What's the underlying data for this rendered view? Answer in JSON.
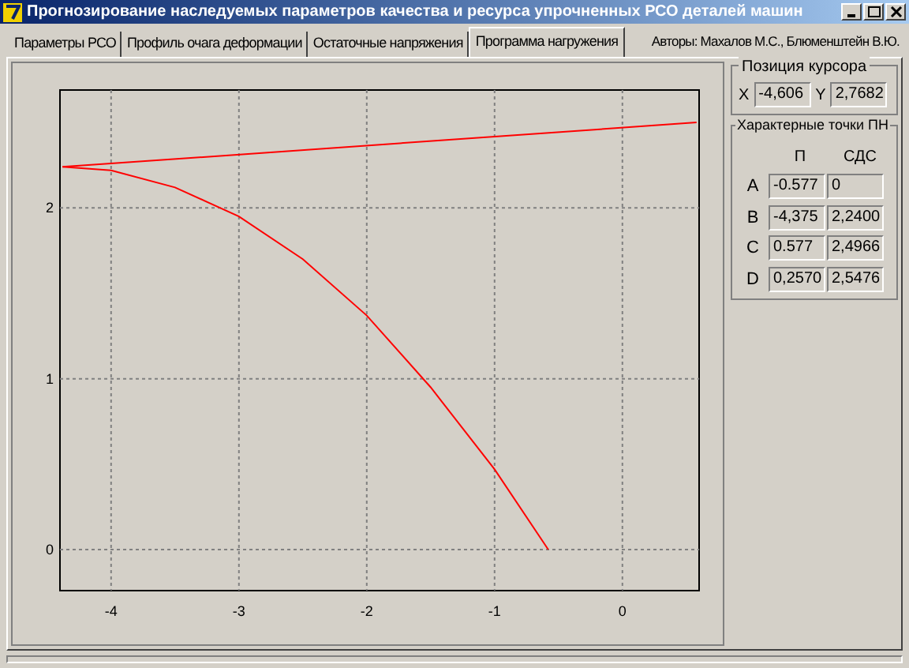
{
  "window": {
    "title": "Прогнозирование наследуемых параметров качества и ресурса упрочненных РСО деталей машин"
  },
  "tabs": [
    {
      "label": "Параметры РСО",
      "selected": false
    },
    {
      "label": "Профиль очага деформации",
      "selected": false
    },
    {
      "label": "Остаточные напряжения",
      "selected": false
    },
    {
      "label": "Программа нагружения",
      "selected": true
    }
  ],
  "authors": "Авторы: Махалов М.С., Блюменштейн В.Ю.",
  "chart": {
    "chart_data": {
      "type": "line",
      "grid": true,
      "xlim": [
        -4.4,
        0.6
      ],
      "ylim": [
        -0.24,
        2.69
      ],
      "xticks": [
        {
          "value": -4,
          "label": "-4"
        },
        {
          "value": -3,
          "label": "-3"
        },
        {
          "value": -2,
          "label": "-2"
        },
        {
          "value": -1,
          "label": "-1"
        },
        {
          "value": 0,
          "label": "0"
        }
      ],
      "yticks": [
        {
          "value": 0,
          "label": "0"
        },
        {
          "value": 1,
          "label": "1"
        },
        {
          "value": 2,
          "label": "2"
        }
      ],
      "series": [
        {
          "color": "#ff0000",
          "x": [
            -4.38,
            0.58
          ],
          "values": [
            2.24,
            2.5
          ]
        },
        {
          "color": "#ff0000",
          "x": [
            -4.38,
            -4,
            -3.5,
            -3,
            -2.5,
            -2,
            -1.5,
            -1,
            -0.58
          ],
          "values": [
            2.24,
            2.22,
            2.12,
            1.95,
            1.7,
            1.37,
            0.95,
            0.47,
            0
          ]
        }
      ]
    }
  },
  "cursor_position": {
    "title": "Позиция курсора",
    "x_label": "X",
    "x_value": "-4,606",
    "y_label": "Y",
    "y_value": "2,7682"
  },
  "points": {
    "title": "Характерные точки ПН",
    "columns": [
      "П",
      "СДС"
    ],
    "rows": [
      {
        "label": "A",
        "p": "-0.577",
        "sds": "0"
      },
      {
        "label": "B",
        "p": "-4,375",
        "sds": "2,2400"
      },
      {
        "label": "C",
        "p": "0.577",
        "sds": "2,4966"
      },
      {
        "label": "D",
        "p": "0,2570",
        "sds": "2,5476"
      }
    ]
  }
}
